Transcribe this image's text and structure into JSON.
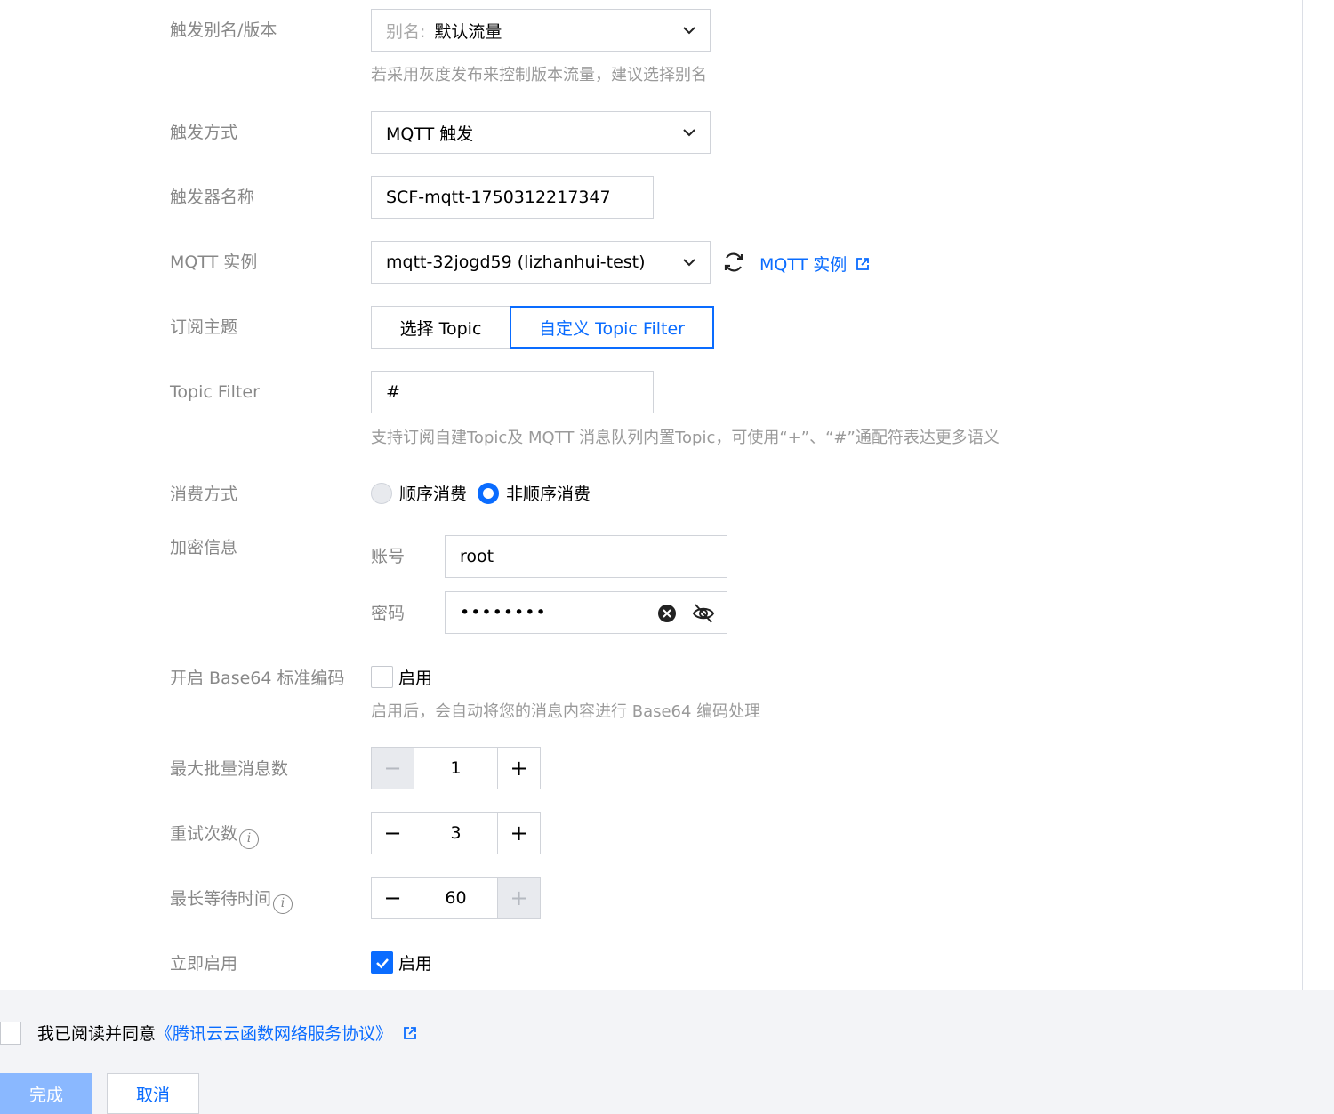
{
  "form": {
    "alias": {
      "label": "触发别名/版本",
      "prefix": "别名:",
      "value": "默认流量",
      "help": "若采用灰度发布来控制版本流量，建议选择别名"
    },
    "trigger_method": {
      "label": "触发方式",
      "value": "MQTT 触发"
    },
    "trigger_name": {
      "label": "触发器名称",
      "value": "SCF-mqtt-1750312217347"
    },
    "mqtt_instance": {
      "label": "MQTT 实例",
      "value": "mqtt-32jogd59 (lizhanhui-test)",
      "link": "MQTT 实例"
    },
    "subscription": {
      "label": "订阅主题",
      "options": [
        "选择 Topic",
        "自定义 Topic Filter"
      ],
      "selected": "自定义 Topic Filter"
    },
    "topic_filter": {
      "label": "Topic Filter",
      "value": "#",
      "help": "支持订阅自建Topic及 MQTT 消息队列内置Topic，可使用“+”、“#”通配符表达更多语义"
    },
    "consume_mode": {
      "label": "消费方式",
      "options": [
        "顺序消费",
        "非顺序消费"
      ],
      "selected": "非顺序消费"
    },
    "encryption": {
      "label": "加密信息",
      "account_label": "账号",
      "account_value": "root",
      "password_label": "密码",
      "password_value": "••••••••"
    },
    "base64": {
      "label": "开启 Base64 标准编码",
      "checkbox_label": "启用",
      "checked": false,
      "help": "启用后，会自动将您的消息内容进行 Base64 编码处理"
    },
    "max_batch": {
      "label": "最大批量消息数",
      "value": "1",
      "minus": "−",
      "plus": "+"
    },
    "retry": {
      "label": "重试次数",
      "value": "3",
      "minus": "−",
      "plus": "+"
    },
    "max_wait": {
      "label": "最长等待时间",
      "value": "60",
      "minus": "−",
      "plus": "+"
    },
    "enable_now": {
      "label": "立即启用",
      "checkbox_label": "启用",
      "checked": true
    }
  },
  "footer": {
    "agree_text": "我已阅读并同意",
    "agree_link": "《腾讯云云函数网络服务协议》",
    "done_label": "完成",
    "cancel_label": "取消"
  },
  "colors": {
    "accent": "#0a6cff",
    "label": "#888888",
    "border": "#d0d3d9",
    "footer_bg": "#f3f4f7"
  },
  "icons": [
    "chevron-down-icon",
    "refresh-icon",
    "external-link-icon",
    "clear-icon",
    "eye-off-icon",
    "info-icon",
    "check-icon"
  ]
}
